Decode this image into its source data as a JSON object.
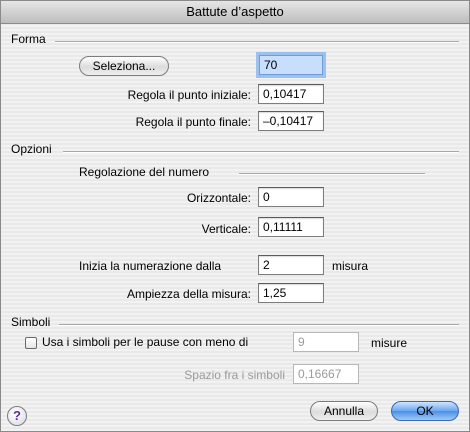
{
  "window": {
    "title": "Battute d’aspetto"
  },
  "forma": {
    "section_label": "Forma",
    "select_button": "Seleziona...",
    "select_value": "70",
    "start_label": "Regola il punto iniziale:",
    "start_value": "0,10417",
    "end_label": "Regola il punto finale:",
    "end_value": "–0,10417"
  },
  "opzioni": {
    "section_label": "Opzioni",
    "subsection_label": "Regolazione del numero",
    "horizontal_label": "Orizzontale:",
    "horizontal_value": "0",
    "vertical_label": "Verticale:",
    "vertical_value": "0,11111",
    "numbering_label": "Inizia la numerazione dalla",
    "numbering_value": "2",
    "numbering_unit": "misura",
    "width_label": "Ampiezza della misura:",
    "width_value": "1,25"
  },
  "simboli": {
    "section_label": "Simboli",
    "checkbox_label": "Usa i simboli per le pause con meno di",
    "checkbox_checked": false,
    "rests_value": "9",
    "rests_unit": "misure",
    "spacing_label": "Spazio fra i simboli",
    "spacing_value": "0,16667"
  },
  "footer": {
    "help_glyph": "?",
    "cancel_label": "Annulla",
    "ok_label": "OK"
  },
  "icons": [
    "help-icon"
  ]
}
